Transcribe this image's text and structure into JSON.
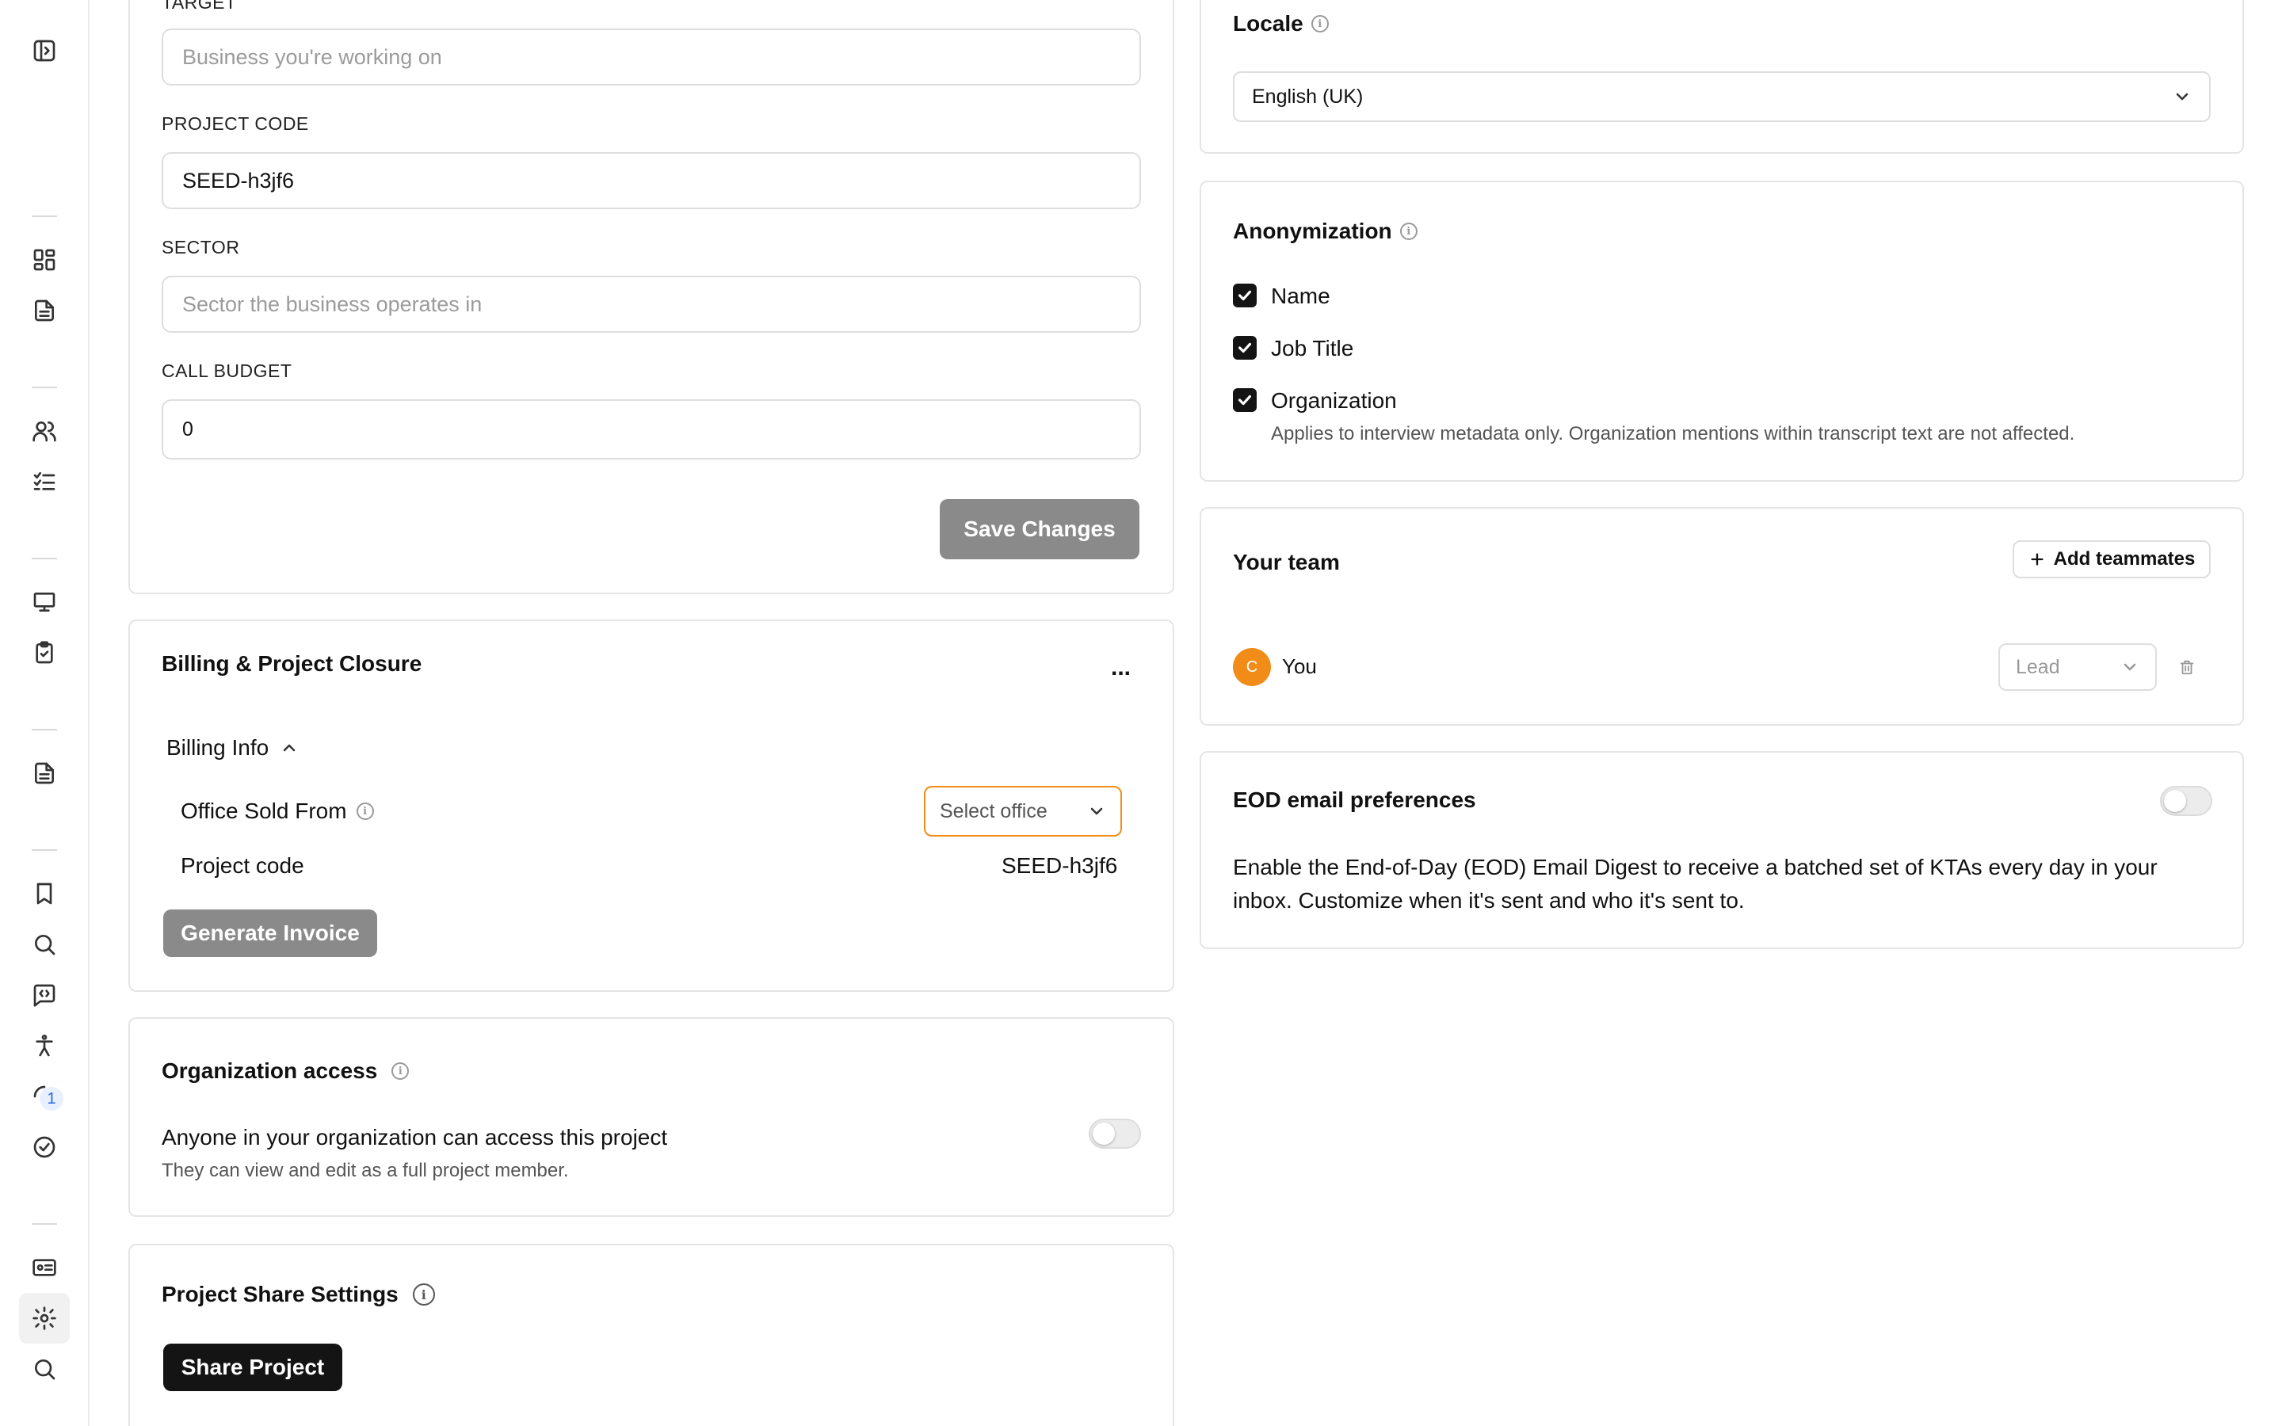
{
  "left_form": {
    "target_label": "TARGET",
    "target_placeholder": "Business you're working on",
    "project_code_label": "PROJECT CODE",
    "project_code_value": "SEED-h3jf6",
    "sector_label": "SECTOR",
    "sector_placeholder": "Sector the business operates in",
    "call_budget_label": "CALL BUDGET",
    "call_budget_value": "0",
    "save_label": "Save Changes"
  },
  "billing": {
    "title": "Billing & Project Closure",
    "menu_label": "...",
    "section_label": "Billing Info",
    "office_label": "Office Sold From",
    "office_select_placeholder": "Select office",
    "project_code_label": "Project code",
    "project_code_value": "SEED-h3jf6",
    "invoice_label": "Generate Invoice"
  },
  "org_access": {
    "title": "Organization access",
    "description": "Anyone in your organization can access this project",
    "subdescription": "They can view and edit as a full project member.",
    "enabled": false
  },
  "share": {
    "title": "Project Share Settings",
    "button_label": "Share Project"
  },
  "locale": {
    "title": "Locale",
    "value": "English (UK)"
  },
  "anonymization": {
    "title": "Anonymization",
    "options": [
      {
        "label": "Name",
        "checked": true
      },
      {
        "label": "Job Title",
        "checked": true
      },
      {
        "label": "Organization",
        "checked": true
      }
    ],
    "note": "Applies to interview metadata only. Organization mentions within transcript text are not affected."
  },
  "team": {
    "title": "Your team",
    "add_label": "Add teammates",
    "members": [
      {
        "initial": "C",
        "name": "You",
        "role": "Lead",
        "avatar_color": "#f28c18"
      }
    ]
  },
  "eod": {
    "title": "EOD email preferences",
    "description": "Enable the End-of-Day (EOD) Email Digest to receive a batched set of KTAs every day in your inbox. Customize when it's sent and who it's sent to.",
    "enabled": false
  },
  "sidebar": {
    "badge_count": "1"
  },
  "colors": {
    "accent_orange": "#f28c18",
    "button_gray": "#8a8a8a",
    "button_dark": "#141414"
  }
}
